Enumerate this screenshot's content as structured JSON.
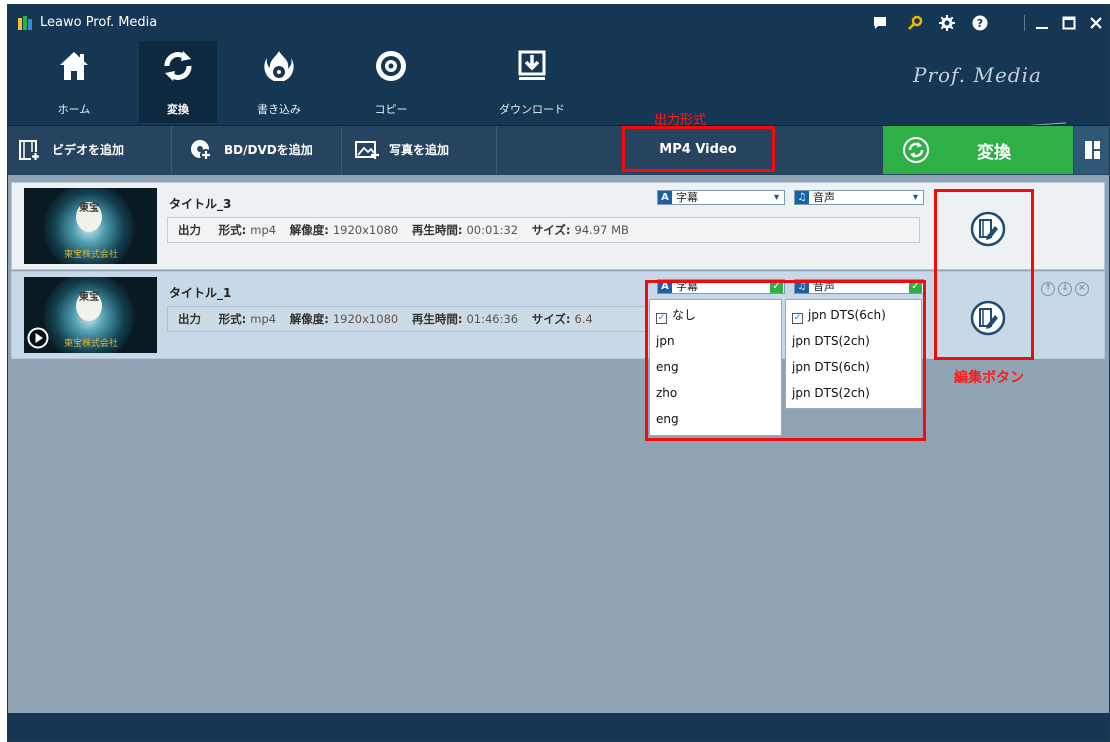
{
  "app": {
    "title": "Leawo Prof. Media",
    "brand": "Prof. Media"
  },
  "nav": [
    {
      "label": "ホーム",
      "icon": "home-icon"
    },
    {
      "label": "変換",
      "icon": "convert-icon"
    },
    {
      "label": "書き込み",
      "icon": "burn-icon"
    },
    {
      "label": "コピー",
      "icon": "copy-icon"
    },
    {
      "label": "ダウンロード",
      "icon": "download-icon"
    }
  ],
  "toolbar": {
    "add_video": "ビデオを追加",
    "add_bd_dvd": "BD/DVDを追加",
    "add_photo": "写真を追加",
    "format": "MP4 Video",
    "convert": "変換"
  },
  "annotations": {
    "output_format": "出力形式",
    "edit_button": "編集ボタン"
  },
  "thumbnail": {
    "logo": "東宝",
    "caption": "東宝株式会社"
  },
  "items": [
    {
      "title": "タイトル_3",
      "output_label": "出力",
      "format_key": "形式:",
      "format": "mp4",
      "res_key": "解像度:",
      "resolution": "1920x1080",
      "dur_key": "再生時間:",
      "duration": "00:01:32",
      "size_key": "サイズ:",
      "size": "94.97 MB",
      "subtitle": "字幕",
      "audio": "音声"
    },
    {
      "title": "タイトル_1",
      "output_label": "出力",
      "format_key": "形式:",
      "format": "mp4",
      "res_key": "解像度:",
      "resolution": "1920x1080",
      "dur_key": "再生時間:",
      "duration": "01:46:36",
      "size_key": "サイズ:",
      "size": "6.4",
      "subtitle": "字幕",
      "audio": "音声"
    }
  ],
  "subtitle_menu": [
    "なし",
    "jpn",
    "eng",
    "zho",
    "eng"
  ],
  "audio_menu": [
    "jpn DTS(6ch)",
    "jpn DTS(2ch)",
    "jpn DTS(6ch)",
    "jpn DTS(2ch)"
  ],
  "colors": {
    "accent_green": "#2fb046",
    "annotation_red": "#ee0c0c",
    "header_navy": "#163754"
  }
}
